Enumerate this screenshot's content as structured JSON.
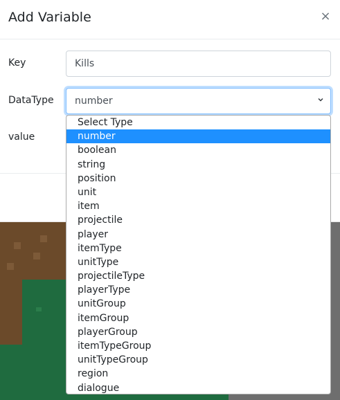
{
  "modal": {
    "title": "Add Variable",
    "close_glyph": "×"
  },
  "form": {
    "key_label": "Key",
    "key_value": "Kills",
    "datatype_label": "DataType",
    "datatype_selected": "number",
    "value_label": "value"
  },
  "dropdown": {
    "selected_index": 1,
    "options": [
      "Select Type",
      "number",
      "boolean",
      "string",
      "position",
      "unit",
      "item",
      "projectile",
      "player",
      "itemType",
      "unitType",
      "projectileType",
      "playerType",
      "unitGroup",
      "itemGroup",
      "playerGroup",
      "itemTypeGroup",
      "unitTypeGroup",
      "region",
      "dialogue"
    ]
  },
  "icons": {
    "close": "close-icon",
    "chevron": "chevron-down-icon"
  },
  "colors": {
    "selected_option_bg": "#1e90ff",
    "focus_border": "#80bdff",
    "dirt": "#6b4a2a",
    "grass": "#1f6b3f"
  }
}
